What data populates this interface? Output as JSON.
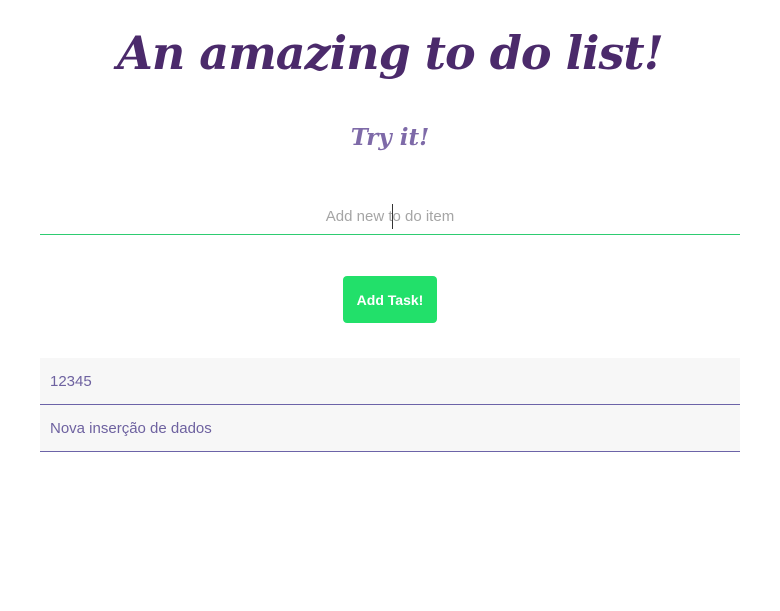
{
  "header": {
    "title": "An amazing to do list!",
    "subtitle": "Try it!"
  },
  "form": {
    "input_placeholder": "Add new to do item",
    "input_value": "",
    "add_button_label": "Add Task!"
  },
  "tasks": [
    {
      "label": "12345"
    },
    {
      "label": "Nova inserção de dados"
    }
  ],
  "colors": {
    "title": "#4b2a6b",
    "subtitle": "#7e6aa8",
    "accent_green": "#22e06a",
    "input_underline": "#2ecc71",
    "task_text": "#6e62a0",
    "task_divider": "#6c63a8",
    "task_background": "#f7f7f7"
  }
}
